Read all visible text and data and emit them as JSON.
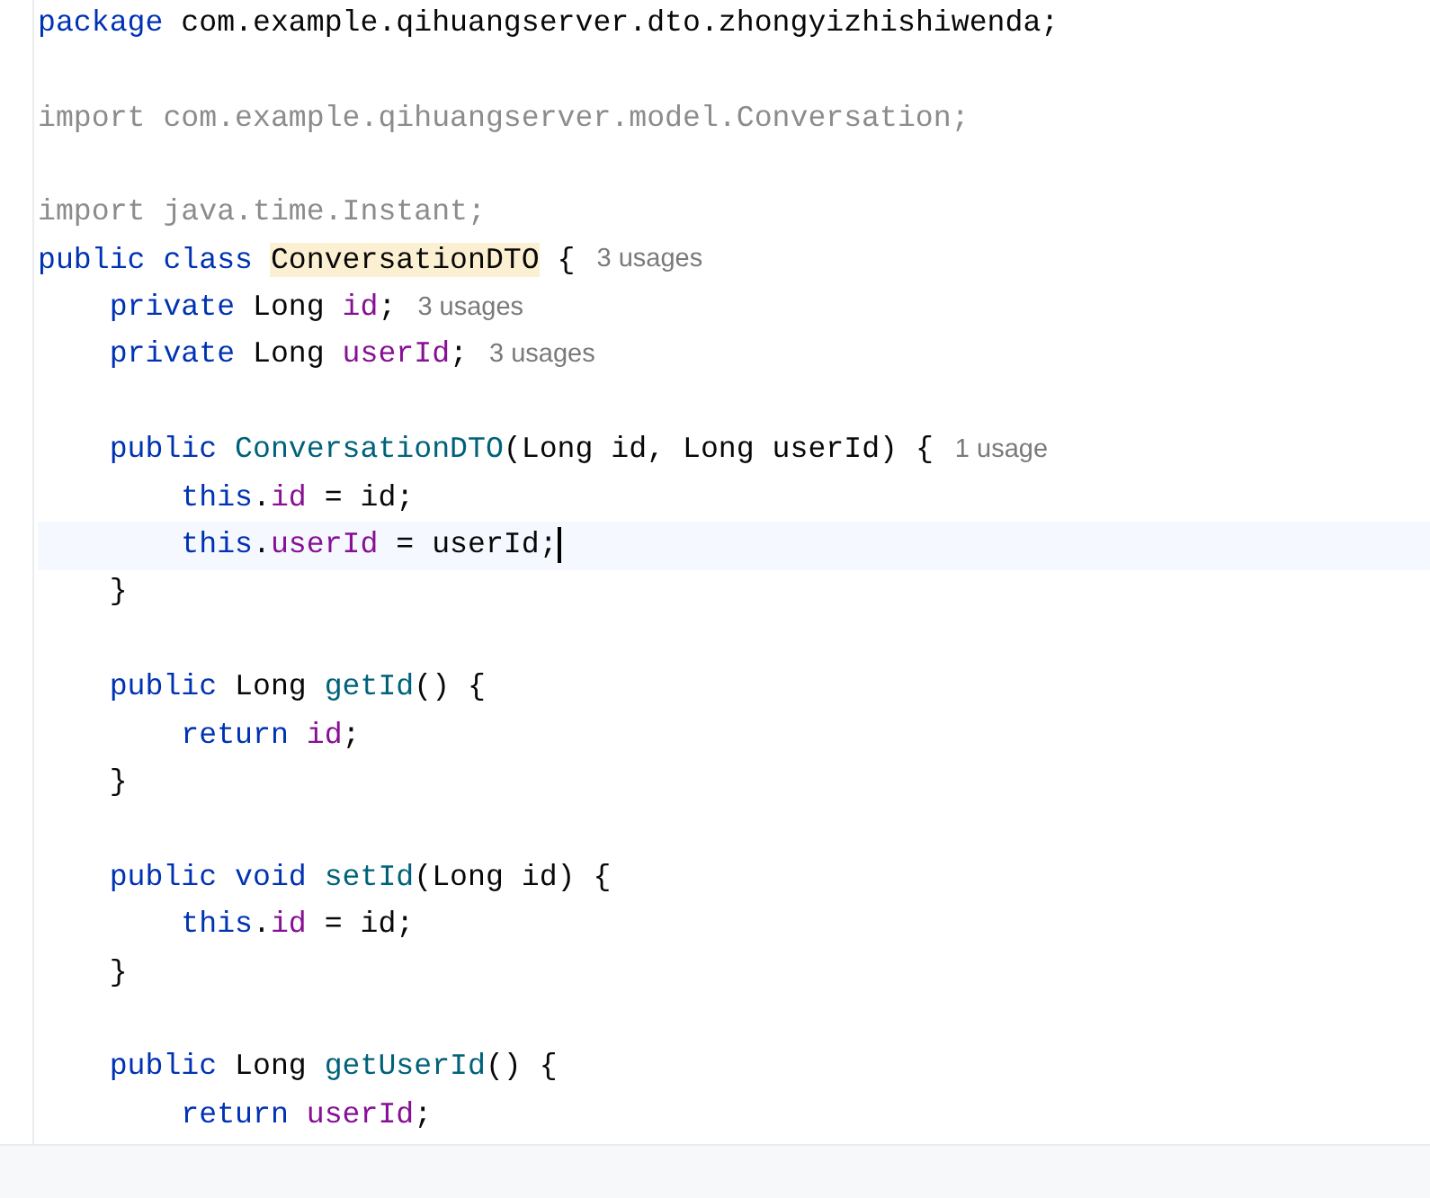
{
  "lines": [
    {
      "kind": "code",
      "current": false,
      "cursor": false,
      "tokens": [
        {
          "kind": "keyword",
          "text": "package"
        },
        {
          "kind": "plain",
          "text": " com.example.qihuangserver.dto.zhongyizhishiwenda;"
        }
      ]
    },
    {
      "kind": "blank",
      "current": false,
      "cursor": false
    },
    {
      "kind": "code",
      "current": false,
      "cursor": false,
      "tokens": [
        {
          "kind": "unused",
          "text": "import com.example.qihuangserver.model.Conversation;"
        }
      ]
    },
    {
      "kind": "blank",
      "current": false,
      "cursor": false
    },
    {
      "kind": "code",
      "current": false,
      "cursor": false,
      "tokens": [
        {
          "kind": "unused",
          "text": "import java.time.Instant;"
        }
      ]
    },
    {
      "kind": "code",
      "current": false,
      "cursor": false,
      "hint": "3 usages",
      "tokens": [
        {
          "kind": "keyword",
          "text": "public class "
        },
        {
          "kind": "highlighted",
          "text": "ConversationDTO"
        },
        {
          "kind": "plain",
          "text": " {"
        }
      ]
    },
    {
      "kind": "code",
      "current": false,
      "cursor": false,
      "hint": "3 usages",
      "tokens": [
        {
          "kind": "keyword",
          "text": "    private "
        },
        {
          "kind": "plain",
          "text": "Long "
        },
        {
          "kind": "field",
          "text": "id"
        },
        {
          "kind": "plain",
          "text": ";"
        }
      ]
    },
    {
      "kind": "code",
      "current": false,
      "cursor": false,
      "hint": "3 usages",
      "tokens": [
        {
          "kind": "keyword",
          "text": "    private "
        },
        {
          "kind": "plain",
          "text": "Long "
        },
        {
          "kind": "field",
          "text": "userId"
        },
        {
          "kind": "plain",
          "text": ";"
        }
      ]
    },
    {
      "kind": "blank",
      "current": false,
      "cursor": false
    },
    {
      "kind": "code",
      "current": false,
      "cursor": false,
      "hint": "1 usage",
      "tokens": [
        {
          "kind": "keyword",
          "text": "    public "
        },
        {
          "kind": "method",
          "text": "ConversationDTO"
        },
        {
          "kind": "plain",
          "text": "(Long id, Long userId) {"
        }
      ]
    },
    {
      "kind": "code",
      "current": false,
      "cursor": false,
      "tokens": [
        {
          "kind": "keyword",
          "text": "        this"
        },
        {
          "kind": "plain",
          "text": "."
        },
        {
          "kind": "field",
          "text": "id"
        },
        {
          "kind": "plain",
          "text": " = id;"
        }
      ]
    },
    {
      "kind": "code",
      "current": true,
      "cursor": true,
      "tokens": [
        {
          "kind": "keyword",
          "text": "        this"
        },
        {
          "kind": "plain",
          "text": "."
        },
        {
          "kind": "field",
          "text": "userId"
        },
        {
          "kind": "plain",
          "text": " = userId;"
        }
      ]
    },
    {
      "kind": "code",
      "current": false,
      "cursor": false,
      "tokens": [
        {
          "kind": "plain",
          "text": "    }"
        }
      ]
    },
    {
      "kind": "blank",
      "current": false,
      "cursor": false
    },
    {
      "kind": "code",
      "current": false,
      "cursor": false,
      "tokens": [
        {
          "kind": "keyword",
          "text": "    public "
        },
        {
          "kind": "plain",
          "text": "Long "
        },
        {
          "kind": "method",
          "text": "getId"
        },
        {
          "kind": "plain",
          "text": "() {"
        }
      ]
    },
    {
      "kind": "code",
      "current": false,
      "cursor": false,
      "tokens": [
        {
          "kind": "keyword",
          "text": "        return "
        },
        {
          "kind": "field",
          "text": "id"
        },
        {
          "kind": "plain",
          "text": ";"
        }
      ]
    },
    {
      "kind": "code",
      "current": false,
      "cursor": false,
      "tokens": [
        {
          "kind": "plain",
          "text": "    }"
        }
      ]
    },
    {
      "kind": "blank",
      "current": false,
      "cursor": false
    },
    {
      "kind": "code",
      "current": false,
      "cursor": false,
      "tokens": [
        {
          "kind": "keyword",
          "text": "    public void "
        },
        {
          "kind": "method",
          "text": "setId"
        },
        {
          "kind": "plain",
          "text": "(Long id) {"
        }
      ]
    },
    {
      "kind": "code",
      "current": false,
      "cursor": false,
      "tokens": [
        {
          "kind": "keyword",
          "text": "        this"
        },
        {
          "kind": "plain",
          "text": "."
        },
        {
          "kind": "field",
          "text": "id"
        },
        {
          "kind": "plain",
          "text": " = id;"
        }
      ]
    },
    {
      "kind": "code",
      "current": false,
      "cursor": false,
      "tokens": [
        {
          "kind": "plain",
          "text": "    }"
        }
      ]
    },
    {
      "kind": "blank",
      "current": false,
      "cursor": false
    },
    {
      "kind": "code",
      "current": false,
      "cursor": false,
      "tokens": [
        {
          "kind": "keyword",
          "text": "    public "
        },
        {
          "kind": "plain",
          "text": "Long "
        },
        {
          "kind": "method",
          "text": "getUserId"
        },
        {
          "kind": "plain",
          "text": "() {"
        }
      ]
    },
    {
      "kind": "code",
      "current": false,
      "cursor": false,
      "tokens": [
        {
          "kind": "keyword",
          "text": "        return "
        },
        {
          "kind": "field",
          "text": "userId"
        },
        {
          "kind": "plain",
          "text": ";"
        }
      ]
    }
  ]
}
